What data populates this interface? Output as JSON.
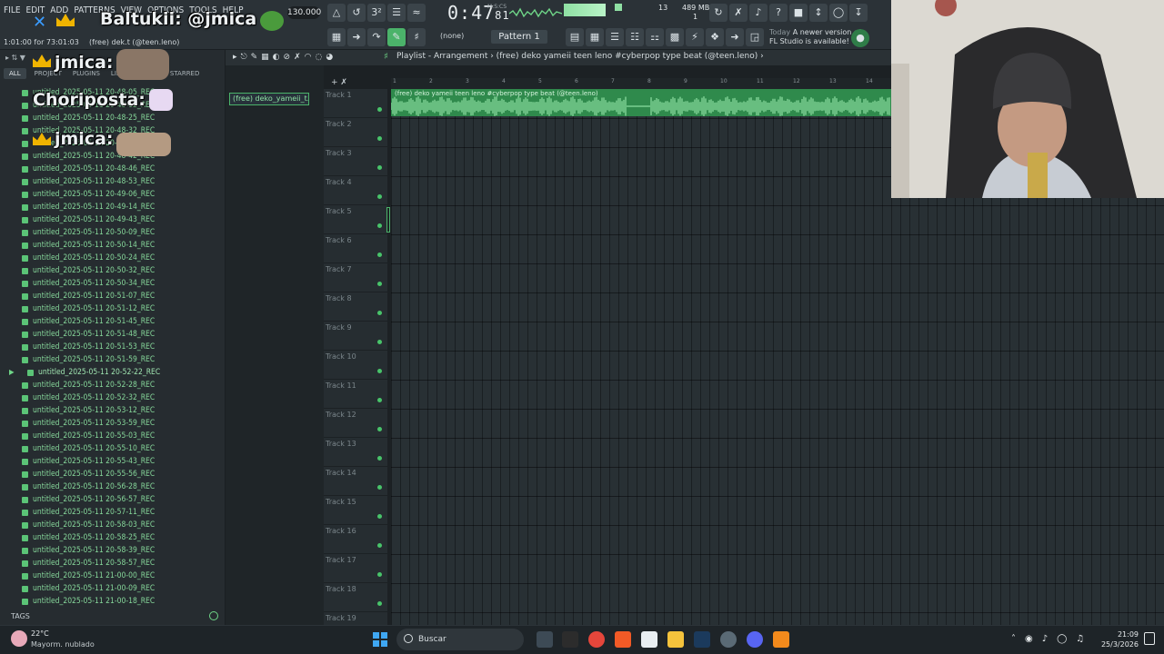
{
  "menu": [
    "FILE",
    "EDIT",
    "ADD",
    "PATTERNS",
    "VIEW",
    "OPTIONS",
    "TOOLS",
    "HELP"
  ],
  "status": {
    "song_pos": "1:01:00 for 73:01:03",
    "hint": "(free) dek.t (@teen.leno)"
  },
  "transport": {
    "tempo": "130.000",
    "time": "0:47",
    "time_frac": "81",
    "msc_label": "M:S:CS",
    "cpu": "13",
    "memory": "489 MB",
    "voices": "1"
  },
  "toolbar": {
    "pattern": "Pattern 1",
    "none_label": "(none)"
  },
  "update": {
    "today": "Today",
    "msg1": "A newer version of",
    "msg2": "FL Studio is available!"
  },
  "overlays": {
    "a": "Baltukii: @jmica",
    "b": "jmica:",
    "c": "Choriposta:",
    "d": "jmica:"
  },
  "browser": {
    "tabs": [
      "ALL",
      "PROJECT",
      "PLUGINS",
      "LIB",
      "SOUNDS",
      "STARRED"
    ],
    "tags_label": "TAGS",
    "files": [
      "untitled_2025-05-11 20-48-05_REC",
      "untitled_2025-05-11 20-48-12_REC",
      "untitled_2025-05-11 20-48-25_REC",
      "untitled_2025-05-11 20-48-32_REC",
      "untitled_2025-05-11 20-48-39_REC",
      "untitled_2025-05-11 20-48-42_REC",
      "untitled_2025-05-11 20-48-46_REC",
      "untitled_2025-05-11 20-48-53_REC",
      "untitled_2025-05-11 20-49-06_REC",
      "untitled_2025-05-11 20-49-14_REC",
      "untitled_2025-05-11 20-49-43_REC",
      "untitled_2025-05-11 20-50-09_REC",
      "untitled_2025-05-11 20-50-14_REC",
      "untitled_2025-05-11 20-50-24_REC",
      "untitled_2025-05-11 20-50-32_REC",
      "untitled_2025-05-11 20-50-34_REC",
      "untitled_2025-05-11 20-51-07_REC",
      "untitled_2025-05-11 20-51-12_REC",
      "untitled_2025-05-11 20-51-45_REC",
      "untitled_2025-05-11 20-51-48_REC",
      "untitled_2025-05-11 20-51-53_REC",
      "untitled_2025-05-11 20-51-59_REC",
      "untitled_2025-05-11 20-52-22_REC",
      "untitled_2025-05-11 20-52-28_REC",
      "untitled_2025-05-11 20-52-32_REC",
      "untitled_2025-05-11 20-53-12_REC",
      "untitled_2025-05-11 20-53-59_REC",
      "untitled_2025-05-11 20-55-03_REC",
      "untitled_2025-05-11 20-55-10_REC",
      "untitled_2025-05-11 20-55-43_REC",
      "untitled_2025-05-11 20-55-56_REC",
      "untitled_2025-05-11 20-56-28_REC",
      "untitled_2025-05-11 20-56-57_REC",
      "untitled_2025-05-11 20-57-11_REC",
      "untitled_2025-05-11 20-58-03_REC",
      "untitled_2025-05-11 20-58-25_REC",
      "untitled_2025-05-11 20-58-39_REC",
      "untitled_2025-05-11 20-58-57_REC",
      "untitled_2025-05-11 21-00-00_REC",
      "untitled_2025-05-11 21-00-09_REC",
      "untitled_2025-05-11 21-00-18_REC"
    ],
    "folder_index": 22
  },
  "pattern_clip": "(free) deko_yameii_t...",
  "playlist": {
    "title": "Playlist - Arrangement › (free) deko  yameii  teen leno #cyberpop type beat (@teen.leno) ›",
    "clip_label": "(free) deko  yameii  teen leno #cyberpop type beat (@teen.leno)",
    "ruler": [
      "1",
      "2",
      "3",
      "4",
      "5",
      "6",
      "7",
      "8",
      "9",
      "10",
      "11",
      "12",
      "13",
      "14"
    ],
    "tracks": [
      "Track 1",
      "Track 2",
      "Track 3",
      "Track 4",
      "Track 5",
      "Track 6",
      "Track 7",
      "Track 8",
      "Track 9",
      "Track 10",
      "Track 11",
      "Track 12",
      "Track 13",
      "Track 14",
      "Track 15",
      "Track 16",
      "Track 17",
      "Track 18",
      "Track 19"
    ]
  },
  "taskbar": {
    "temp": "22°C",
    "weather": "Mayorm. nublado",
    "search": "Buscar",
    "time": "21:09",
    "date": "25/3/2026"
  },
  "colors": {
    "accent": "#4bb36a",
    "clip": "#2f8a4c",
    "bg": "#1c2124"
  }
}
